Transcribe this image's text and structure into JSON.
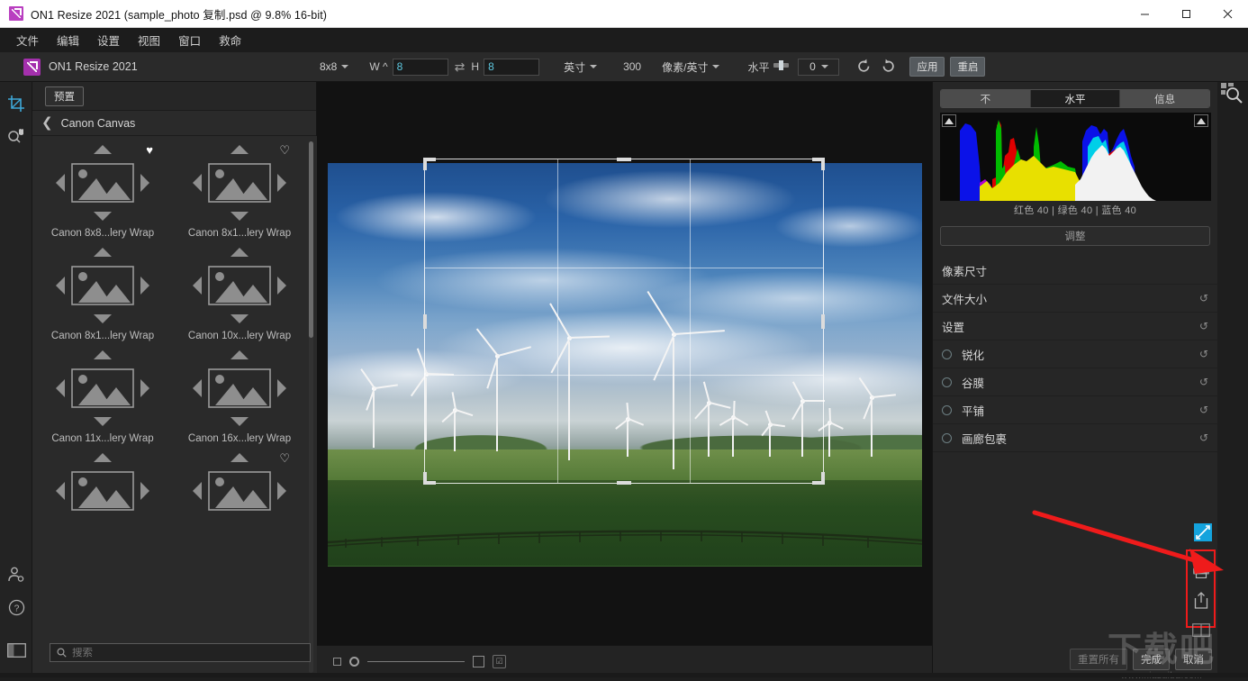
{
  "window": {
    "title": "ON1 Resize 2021 (sample_photo 复制.psd @ 9.8% 16-bit)",
    "icon": "on1-logo-icon",
    "minimize": "—",
    "maximize": "❐",
    "close": "✕"
  },
  "menubar": {
    "items": [
      {
        "label": "文件"
      },
      {
        "label": "编辑"
      },
      {
        "label": "设置"
      },
      {
        "label": "视图"
      },
      {
        "label": "窗口"
      },
      {
        "label": "救命"
      }
    ]
  },
  "toolbar": {
    "brand": "ON1 Resize 2021",
    "ratio_preset": "8x8",
    "width_label": "W ^",
    "width_value": "8",
    "swap_icon": "swap-arrows-icon",
    "height_label": "H",
    "height_value": "8",
    "unit": "英寸",
    "resolution": "300",
    "resolution_unit": "像素/英寸",
    "level_label": "水平",
    "level_value": "0",
    "rotate_ccw_icon": "rotate-ccw-icon",
    "rotate_cw_icon": "rotate-cw-icon",
    "apply_label": "应用",
    "reset_label": "重启"
  },
  "rail": {
    "items": [
      {
        "name": "crop-tool",
        "icon": "crop-icon",
        "active": true
      },
      {
        "name": "zoom-pan-tool",
        "icon": "magnifier-hand-icon",
        "active": false
      }
    ],
    "bottom_items": [
      {
        "name": "account",
        "icon": "user-gear-icon"
      },
      {
        "name": "help",
        "icon": "question-circle-icon"
      },
      {
        "name": "toggle-panel",
        "icon": "panel-layout-icon"
      }
    ]
  },
  "left_panel": {
    "tab_label": "预置",
    "breadcrumb_back_icon": "chevron-left-icon",
    "breadcrumb": "Canon Canvas",
    "search_placeholder": "搜索",
    "search_icon": "search-icon",
    "presets": [
      {
        "label": "Canon 8x8...lery Wrap",
        "favorite": true
      },
      {
        "label": "Canon 8x1...lery Wrap",
        "favorite": false
      },
      {
        "label": "Canon 8x1...lery Wrap",
        "favorite": false
      },
      {
        "label": "Canon 10x...lery Wrap",
        "favorite": false
      },
      {
        "label": "Canon 11x...lery Wrap",
        "favorite": false
      },
      {
        "label": "Canon 16x...lery Wrap",
        "favorite": false
      },
      {
        "label": "",
        "favorite": false
      },
      {
        "label": "",
        "favorite": true
      }
    ]
  },
  "canvas_bar": {
    "small_square_icon": "small-square-icon",
    "slider_knob_icon": "slider-knob-icon",
    "large_square_icon": "large-square-icon",
    "checker_icon": "check-square-icon"
  },
  "right_panel": {
    "tabs": [
      {
        "label": "不",
        "active": false
      },
      {
        "label": "水平",
        "active": true
      },
      {
        "label": "信息",
        "active": false
      }
    ],
    "histogram_label": "红色  40  | 绿色  40  | 蓝色  40",
    "adjust_label": "调整",
    "rows": [
      {
        "label": "像素尺寸",
        "radio": false,
        "reset": false
      },
      {
        "label": "文件大小",
        "radio": false,
        "reset": true
      },
      {
        "label": "设置",
        "radio": false,
        "reset": true
      },
      {
        "label": "锐化",
        "radio": true,
        "reset": true
      },
      {
        "label": "谷膜",
        "radio": true,
        "reset": true
      },
      {
        "label": "平铺",
        "radio": true,
        "reset": true
      },
      {
        "label": "画廊包裹",
        "radio": true,
        "reset": true
      }
    ],
    "side_icons": [
      {
        "name": "expand-arrows-icon"
      },
      {
        "name": "print-icon"
      },
      {
        "name": "share-export-icon"
      },
      {
        "name": "compare-view-icon"
      }
    ],
    "footer": {
      "reset_all": "重置所有",
      "done": "完成",
      "cancel": "取消"
    },
    "browse_icon": "browse-zoom-icon"
  },
  "watermark": {
    "big": "下载吧",
    "small": "www.xiazaiba.com"
  },
  "colors": {
    "accent_purple": "#a430ad",
    "input_text": "#5ec8e0",
    "annotation_red": "#ef1b1b",
    "panel_bg": "#262626",
    "canvas_bg": "#121212",
    "histogram": [
      "#0b0b0b",
      "#0000ff",
      "#ff0000",
      "#00c000",
      "#ffff00",
      "#00d0e0",
      "#ffffff"
    ]
  }
}
